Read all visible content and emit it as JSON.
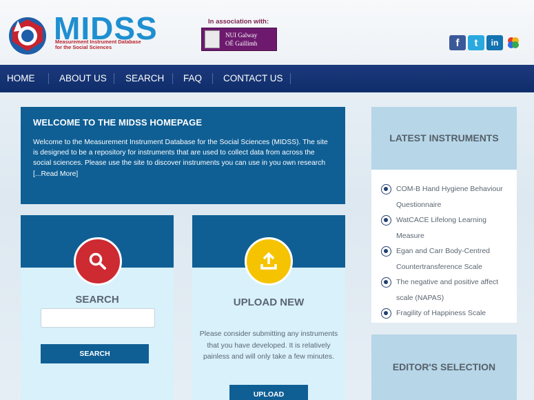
{
  "header": {
    "logo_title": "MIDSS",
    "logo_subtitle_line1": "Measurement Instrument Database",
    "logo_subtitle_line2": "for the Social Sciences",
    "association_label": "In association with:",
    "partner_line1": "NUI Galway",
    "partner_line2": "OÉ Gaillimh",
    "social": [
      {
        "icon": "facebook-icon",
        "glyph": "f"
      },
      {
        "icon": "twitter-icon",
        "glyph": "t"
      },
      {
        "icon": "linkedin-icon",
        "glyph": "in"
      },
      {
        "icon": "google-plus-icon",
        "glyph": "8"
      }
    ]
  },
  "nav": {
    "items": [
      "HOME",
      "ABOUT US",
      "SEARCH",
      "FAQ",
      "CONTACT US"
    ]
  },
  "welcome": {
    "title": "WELCOME TO THE MIDSS HOMEPAGE",
    "body": "Welcome to the Measurement Instrument Database for the Social Sciences (MIDSS). The site is designed to be a repository for instruments that are used to collect data from across the social sciences. Please use the site to discover instruments you can use in you own research [...Read More]"
  },
  "search_card": {
    "title": "SEARCH",
    "input_value": "",
    "button_label": "SEARCH",
    "icon": "magnifier-icon"
  },
  "upload_card": {
    "title": "UPLOAD NEW",
    "description": "Please consider submitting any instruments that you have developed. It is relatively painless and will only take a few minutes.",
    "button_label": "UPLOAD",
    "icon": "upload-icon"
  },
  "sidebar": {
    "latest_title": "LATEST INSTRUMENTS",
    "latest_items": [
      "COM-B Hand Hygiene Behaviour Questionnaire",
      "WatCACE Lifelong Learning Measure",
      "Egan and Carr Body-Centred Countertransference Scale",
      "The negative and positive affect scale (NAPAS)",
      "Fragility of Happiness Scale"
    ],
    "editors_title": "EDITOR'S SELECTION"
  },
  "colors": {
    "primary_blue": "#0f5f95",
    "nav_blue": "#1c3a7c",
    "search_red": "#cd2a32",
    "upload_yellow": "#f5c300",
    "card_bg": "#d8f1fb",
    "sidebar_head": "#b7d6e8"
  }
}
